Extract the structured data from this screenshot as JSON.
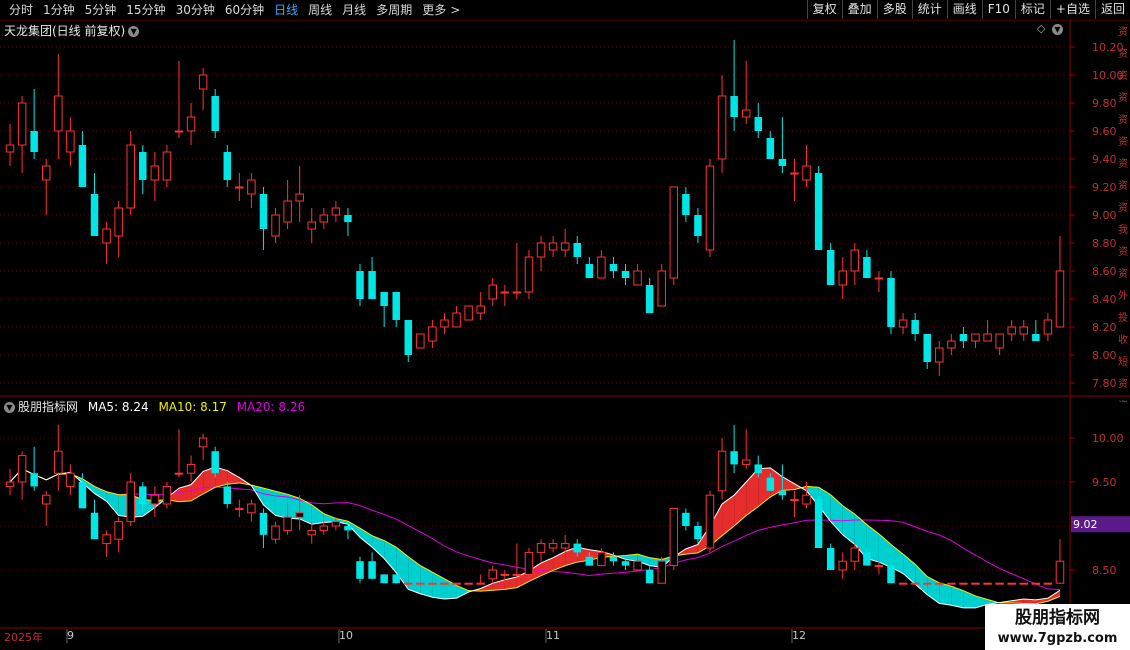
{
  "periods": [
    "分时",
    "1分钟",
    "5分钟",
    "15分钟",
    "30分钟",
    "60分钟",
    "日线",
    "周线",
    "月线",
    "多周期",
    "更多"
  ],
  "active_period": "日线",
  "more_arrow": ">",
  "right_buttons": [
    "复权",
    "叠加",
    "多股",
    "统计",
    "画线",
    "F10",
    "标记",
    "+自选",
    "返回"
  ],
  "main_panel": {
    "title": "天龙集团(日线 前复权)",
    "y_ticks": [
      "10.20",
      "10.00",
      "9.80",
      "9.60",
      "9.40",
      "9.20",
      "9.00",
      "8.80",
      "8.60",
      "8.40",
      "8.20",
      "8.00",
      "7.80"
    ]
  },
  "indicator_panel": {
    "title": "股朋指标网",
    "ma5_label": "MA5: 8.24",
    "ma10_label": "MA10: 8.17",
    "ma20_label": "MA20: 8.26",
    "y_ticks": [
      "10.00",
      "9.50",
      "9.00",
      "8.50"
    ],
    "price_tag": "9.02"
  },
  "date_axis": {
    "year": "2025年",
    "months": [
      "9",
      "10",
      "11",
      "12"
    ]
  },
  "watermark": {
    "line1": "股朋指标网",
    "line2": "www.7gpzb.com"
  },
  "colors": {
    "up": "#ff3232",
    "down": "#00e6e6",
    "ma5": "#ffffff",
    "ma10": "#f0f000",
    "ma20": "#e000e0",
    "grid": "#5a0000",
    "accent": "#3fa7ff"
  },
  "candles": [
    {
      "o": 9.45,
      "h": 9.65,
      "l": 9.35,
      "c": 9.5
    },
    {
      "o": 9.5,
      "h": 9.85,
      "l": 9.3,
      "c": 9.8
    },
    {
      "o": 9.6,
      "h": 9.9,
      "l": 9.4,
      "c": 9.45
    },
    {
      "o": 9.25,
      "h": 9.4,
      "l": 9.0,
      "c": 9.35
    },
    {
      "o": 9.6,
      "h": 10.15,
      "l": 9.4,
      "c": 9.85
    },
    {
      "o": 9.45,
      "h": 9.7,
      "l": 9.35,
      "c": 9.6
    },
    {
      "o": 9.5,
      "h": 9.6,
      "l": 9.2,
      "c": 9.2
    },
    {
      "o": 9.15,
      "h": 9.3,
      "l": 8.9,
      "c": 8.85
    },
    {
      "o": 8.8,
      "h": 8.95,
      "l": 8.65,
      "c": 8.9
    },
    {
      "o": 8.85,
      "h": 9.1,
      "l": 8.7,
      "c": 9.05
    },
    {
      "o": 9.05,
      "h": 9.6,
      "l": 9.0,
      "c": 9.5
    },
    {
      "o": 9.45,
      "h": 9.5,
      "l": 9.15,
      "c": 9.25
    },
    {
      "o": 9.25,
      "h": 9.45,
      "l": 9.1,
      "c": 9.35
    },
    {
      "o": 9.25,
      "h": 9.5,
      "l": 9.2,
      "c": 9.45
    },
    {
      "o": 9.6,
      "h": 10.1,
      "l": 9.55,
      "c": 9.6
    },
    {
      "o": 9.6,
      "h": 9.8,
      "l": 9.5,
      "c": 9.7
    },
    {
      "o": 9.9,
      "h": 10.05,
      "l": 9.75,
      "c": 10.0
    },
    {
      "o": 9.85,
      "h": 9.9,
      "l": 9.55,
      "c": 9.6
    },
    {
      "o": 9.45,
      "h": 9.5,
      "l": 9.2,
      "c": 9.25
    },
    {
      "o": 9.2,
      "h": 9.3,
      "l": 9.1,
      "c": 9.2
    },
    {
      "o": 9.15,
      "h": 9.3,
      "l": 9.05,
      "c": 9.25
    },
    {
      "o": 9.15,
      "h": 9.2,
      "l": 8.75,
      "c": 8.9
    },
    {
      "o": 8.85,
      "h": 9.05,
      "l": 8.8,
      "c": 9.0
    },
    {
      "o": 8.95,
      "h": 9.25,
      "l": 8.9,
      "c": 9.1
    },
    {
      "o": 9.1,
      "h": 9.35,
      "l": 8.95,
      "c": 9.15
    },
    {
      "o": 8.9,
      "h": 9.05,
      "l": 8.8,
      "c": 8.95
    },
    {
      "o": 8.95,
      "h": 9.05,
      "l": 8.9,
      "c": 9.0
    },
    {
      "o": 9.0,
      "h": 9.1,
      "l": 8.95,
      "c": 9.05
    },
    {
      "o": 9.0,
      "h": 9.05,
      "l": 8.85,
      "c": 8.95
    },
    {
      "o": 8.6,
      "h": 8.65,
      "l": 8.35,
      "c": 8.4
    },
    {
      "o": 8.6,
      "h": 8.7,
      "l": 8.4,
      "c": 8.4
    },
    {
      "o": 8.45,
      "h": 8.45,
      "l": 8.2,
      "c": 8.35
    },
    {
      "o": 8.45,
      "h": 8.45,
      "l": 8.2,
      "c": 8.25
    },
    {
      "o": 8.25,
      "h": 8.25,
      "l": 7.95,
      "c": 8.0
    },
    {
      "o": 8.05,
      "h": 8.15,
      "l": 8.05,
      "c": 8.15
    },
    {
      "o": 8.1,
      "h": 8.25,
      "l": 8.05,
      "c": 8.2
    },
    {
      "o": 8.2,
      "h": 8.3,
      "l": 8.15,
      "c": 8.25
    },
    {
      "o": 8.2,
      "h": 8.35,
      "l": 8.2,
      "c": 8.3
    },
    {
      "o": 8.25,
      "h": 8.35,
      "l": 8.25,
      "c": 8.35
    },
    {
      "o": 8.3,
      "h": 8.45,
      "l": 8.25,
      "c": 8.35
    },
    {
      "o": 8.4,
      "h": 8.55,
      "l": 8.35,
      "c": 8.5
    },
    {
      "o": 8.45,
      "h": 8.5,
      "l": 8.35,
      "c": 8.45
    },
    {
      "o": 8.45,
      "h": 8.8,
      "l": 8.4,
      "c": 8.45
    },
    {
      "o": 8.45,
      "h": 8.75,
      "l": 8.4,
      "c": 8.7
    },
    {
      "o": 8.7,
      "h": 8.85,
      "l": 8.6,
      "c": 8.8
    },
    {
      "o": 8.75,
      "h": 8.85,
      "l": 8.7,
      "c": 8.8
    },
    {
      "o": 8.75,
      "h": 8.9,
      "l": 8.7,
      "c": 8.8
    },
    {
      "o": 8.8,
      "h": 8.85,
      "l": 8.65,
      "c": 8.7
    },
    {
      "o": 8.65,
      "h": 8.7,
      "l": 8.55,
      "c": 8.55
    },
    {
      "o": 8.55,
      "h": 8.75,
      "l": 8.55,
      "c": 8.7
    },
    {
      "o": 8.65,
      "h": 8.7,
      "l": 8.55,
      "c": 8.6
    },
    {
      "o": 8.6,
      "h": 8.65,
      "l": 8.5,
      "c": 8.55
    },
    {
      "o": 8.5,
      "h": 8.65,
      "l": 8.5,
      "c": 8.6
    },
    {
      "o": 8.5,
      "h": 8.55,
      "l": 8.3,
      "c": 8.3
    },
    {
      "o": 8.35,
      "h": 8.65,
      "l": 8.35,
      "c": 8.6
    },
    {
      "o": 8.55,
      "h": 9.2,
      "l": 8.5,
      "c": 9.2
    },
    {
      "o": 9.15,
      "h": 9.2,
      "l": 8.95,
      "c": 9.0
    },
    {
      "o": 9.0,
      "h": 9.05,
      "l": 8.8,
      "c": 8.85
    },
    {
      "o": 8.75,
      "h": 9.4,
      "l": 8.7,
      "c": 9.35
    },
    {
      "o": 9.4,
      "h": 10.0,
      "l": 9.3,
      "c": 9.85
    },
    {
      "o": 9.85,
      "h": 10.25,
      "l": 9.6,
      "c": 9.7
    },
    {
      "o": 9.7,
      "h": 10.1,
      "l": 9.65,
      "c": 9.75
    },
    {
      "o": 9.7,
      "h": 9.8,
      "l": 9.55,
      "c": 9.6
    },
    {
      "o": 9.55,
      "h": 9.6,
      "l": 9.4,
      "c": 9.4
    },
    {
      "o": 9.4,
      "h": 9.7,
      "l": 9.3,
      "c": 9.35
    },
    {
      "o": 9.3,
      "h": 9.4,
      "l": 9.1,
      "c": 9.3
    },
    {
      "o": 9.25,
      "h": 9.5,
      "l": 9.2,
      "c": 9.35
    },
    {
      "o": 9.3,
      "h": 9.35,
      "l": 8.75,
      "c": 8.75
    },
    {
      "o": 8.75,
      "h": 8.8,
      "l": 8.5,
      "c": 8.5
    },
    {
      "o": 8.5,
      "h": 8.7,
      "l": 8.4,
      "c": 8.6
    },
    {
      "o": 8.6,
      "h": 8.8,
      "l": 8.5,
      "c": 8.75
    },
    {
      "o": 8.7,
      "h": 8.75,
      "l": 8.55,
      "c": 8.55
    },
    {
      "o": 8.55,
      "h": 8.6,
      "l": 8.45,
      "c": 8.55
    },
    {
      "o": 8.55,
      "h": 8.6,
      "l": 8.15,
      "c": 8.2
    },
    {
      "o": 8.2,
      "h": 8.3,
      "l": 8.15,
      "c": 8.25
    },
    {
      "o": 8.25,
      "h": 8.3,
      "l": 8.1,
      "c": 8.15
    },
    {
      "o": 8.15,
      "h": 8.15,
      "l": 7.9,
      "c": 7.95
    },
    {
      "o": 7.95,
      "h": 8.1,
      "l": 7.85,
      "c": 8.05
    },
    {
      "o": 8.05,
      "h": 8.15,
      "l": 8.0,
      "c": 8.1
    },
    {
      "o": 8.15,
      "h": 8.2,
      "l": 8.05,
      "c": 8.1
    },
    {
      "o": 8.1,
      "h": 8.15,
      "l": 8.05,
      "c": 8.15
    },
    {
      "o": 8.1,
      "h": 8.25,
      "l": 8.1,
      "c": 8.15
    },
    {
      "o": 8.05,
      "h": 8.15,
      "l": 8.0,
      "c": 8.15
    },
    {
      "o": 8.15,
      "h": 8.25,
      "l": 8.1,
      "c": 8.2
    },
    {
      "o": 8.15,
      "h": 8.25,
      "l": 8.1,
      "c": 8.2
    },
    {
      "o": 8.15,
      "h": 8.25,
      "l": 8.1,
      "c": 8.1
    },
    {
      "o": 8.15,
      "h": 8.3,
      "l": 8.1,
      "c": 8.25
    },
    {
      "o": 8.2,
      "h": 8.85,
      "l": 8.2,
      "c": 8.6
    }
  ],
  "side_labels": [
    "资",
    "资",
    "资",
    "资",
    "资",
    "资",
    "资",
    "资",
    "资",
    "我",
    "资",
    "资",
    "外",
    "投",
    "收",
    "短",
    "资",
    "资"
  ]
}
